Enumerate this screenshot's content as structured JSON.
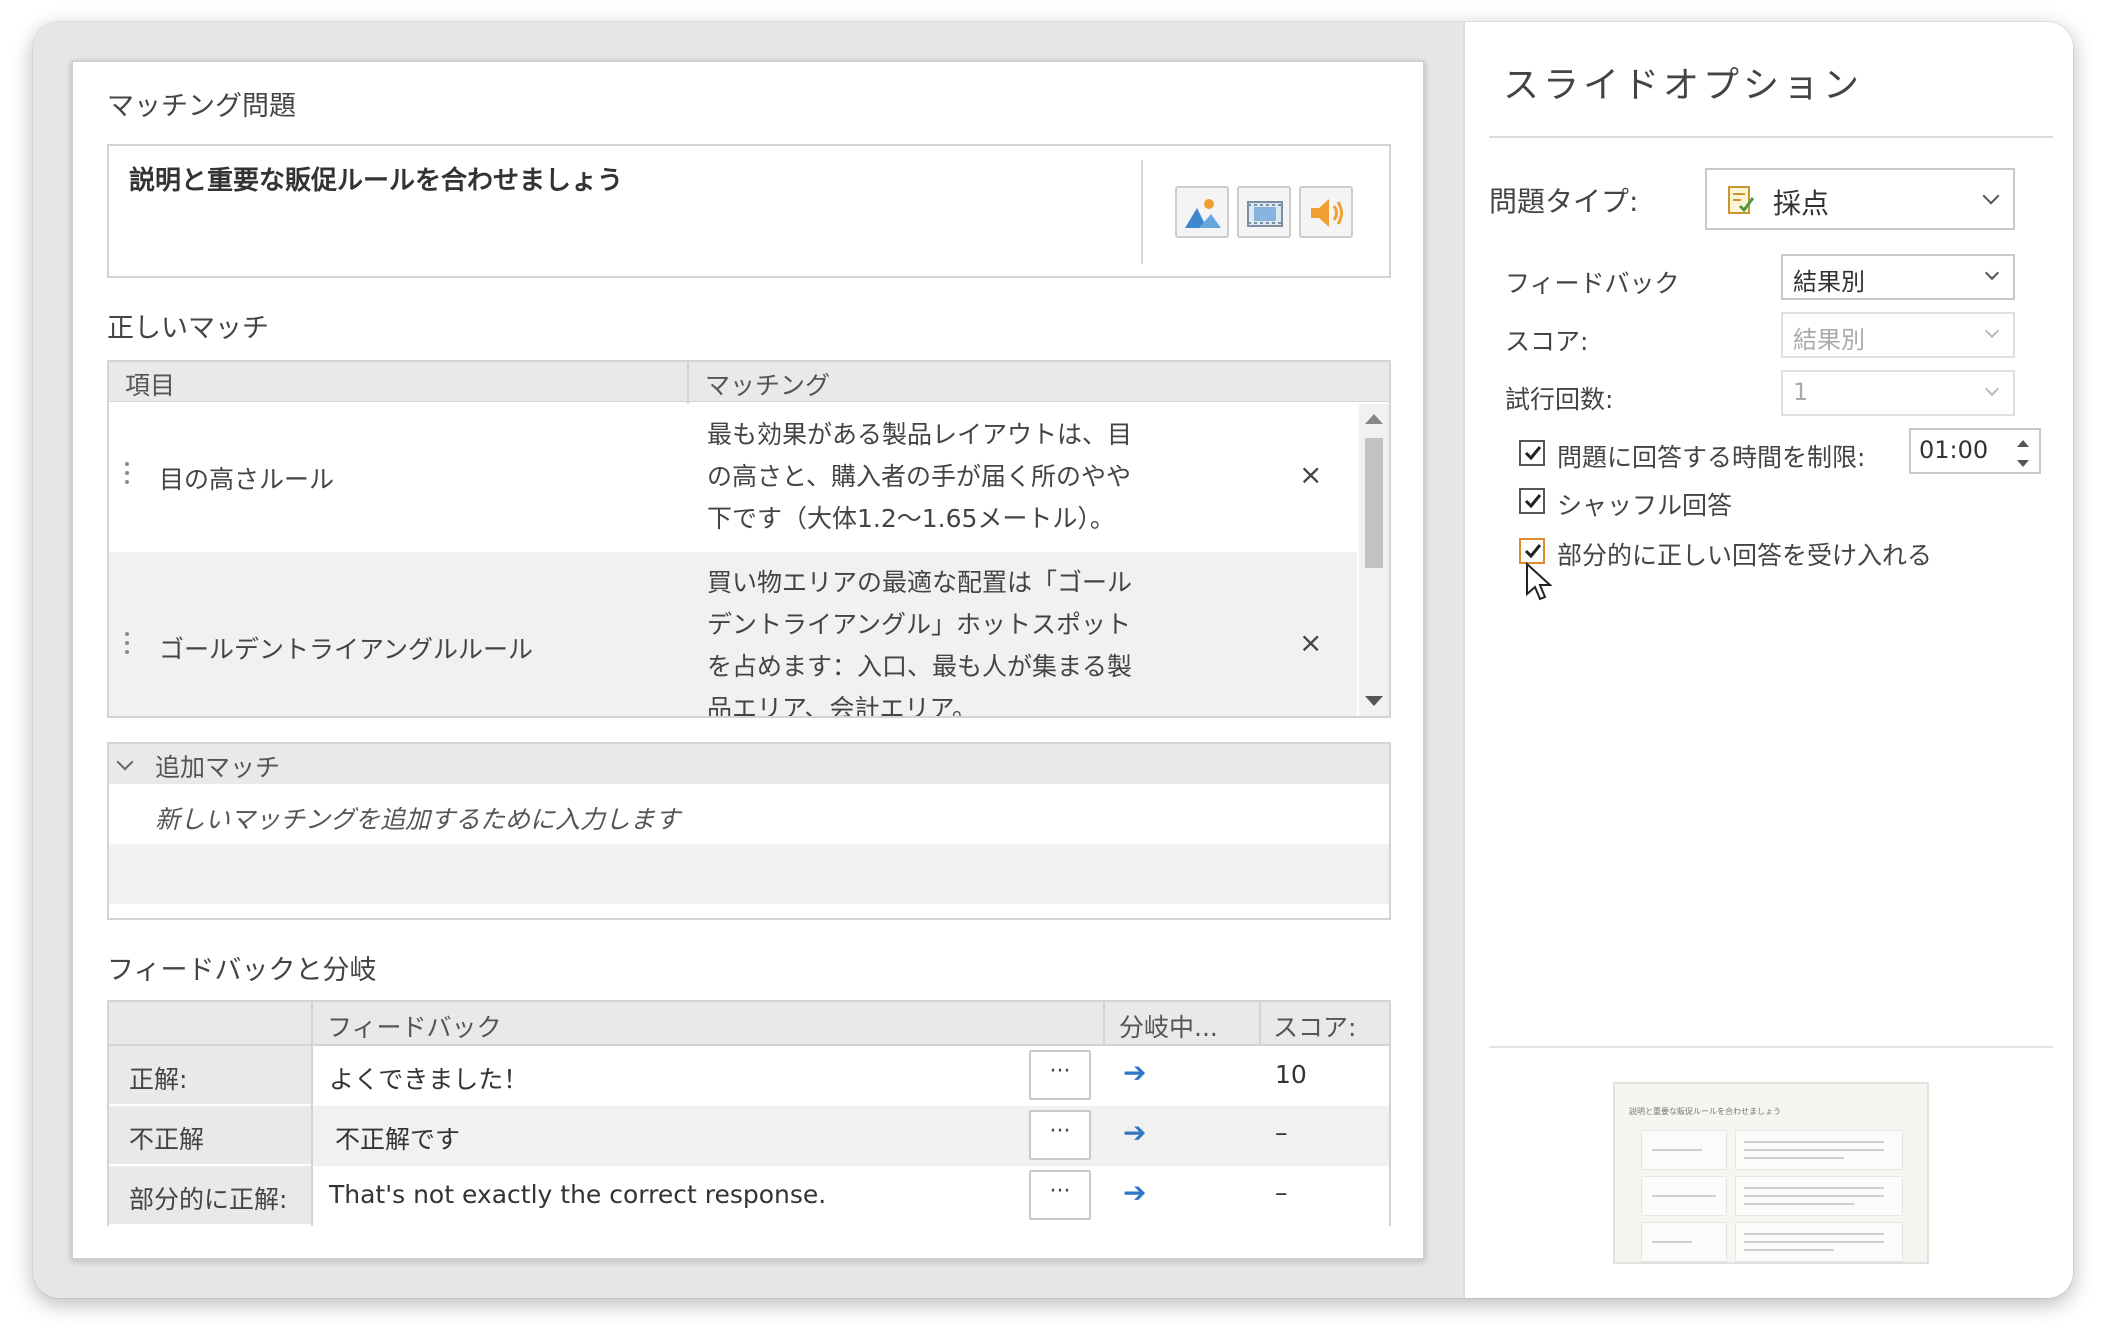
{
  "editor": {
    "section_title": "マッチング問題",
    "question_text": "説明と重要な販促ルールを合わせましょう",
    "media_buttons": [
      "image-icon",
      "video-icon",
      "audio-icon"
    ]
  },
  "matches": {
    "section_title": "正しいマッチ",
    "col_item": "項目",
    "col_matching": "マッチング",
    "rows": [
      {
        "item": "目の高さルール",
        "lines": [
          "最も効果がある製品レイアウトは、目",
          "の高さと、購入者の手が届く所のやや",
          "下です（大体1.2～1.65メートル）。"
        ],
        "delete": "×"
      },
      {
        "item": "ゴールデントライアングルルール",
        "lines": [
          "買い物エリアの最適な配置は「ゴール",
          "デントライアングル」ホットスポット",
          "を占めます：入口、最も人が集まる製",
          "品エリア、会計エリア。"
        ],
        "delete": "×"
      }
    ]
  },
  "additional": {
    "header": "追加マッチ",
    "placeholder": "新しいマッチングを追加するために入力します"
  },
  "feedback": {
    "section_title": "フィードバックと分岐",
    "col_feedback": "フィードバック",
    "col_branch": "分岐中...",
    "col_score": "スコア:",
    "rows": [
      {
        "label": "正解:",
        "text": "よくできました！",
        "more": "···",
        "arrow": "➔",
        "score": "10"
      },
      {
        "label": "不正解",
        "text": "不正解です",
        "more": "···",
        "arrow": "➔",
        "score": "–"
      },
      {
        "label": "部分的に正解:",
        "text": "That's not exactly the correct response.",
        "more": "···",
        "arrow": "➔",
        "score": "–"
      }
    ]
  },
  "options": {
    "title": "スライドオプション",
    "question_type_label": "問題タイプ:",
    "question_type_value": "採点",
    "feedback_label": "フィードバック",
    "feedback_value": "結果別",
    "score_label": "スコア:",
    "score_value": "結果別",
    "attempts_label": "試行回数:",
    "attempts_value": "1",
    "time_limit_label": "問題に回答する時間を制限:",
    "time_limit_value": "01:00",
    "time_limit_checked": true,
    "shuffle_label": "シャッフル回答",
    "shuffle_checked": true,
    "partial_label": "部分的に正しい回答を受け入れる",
    "partial_checked": true
  },
  "thumbnail": {
    "title": "説明と重要な販促ルールを合わせましょう"
  },
  "colors": {
    "accent_arrow": "#2f78c4",
    "icon_orange": "#f0a030",
    "icon_blue": "#3f88cf"
  }
}
